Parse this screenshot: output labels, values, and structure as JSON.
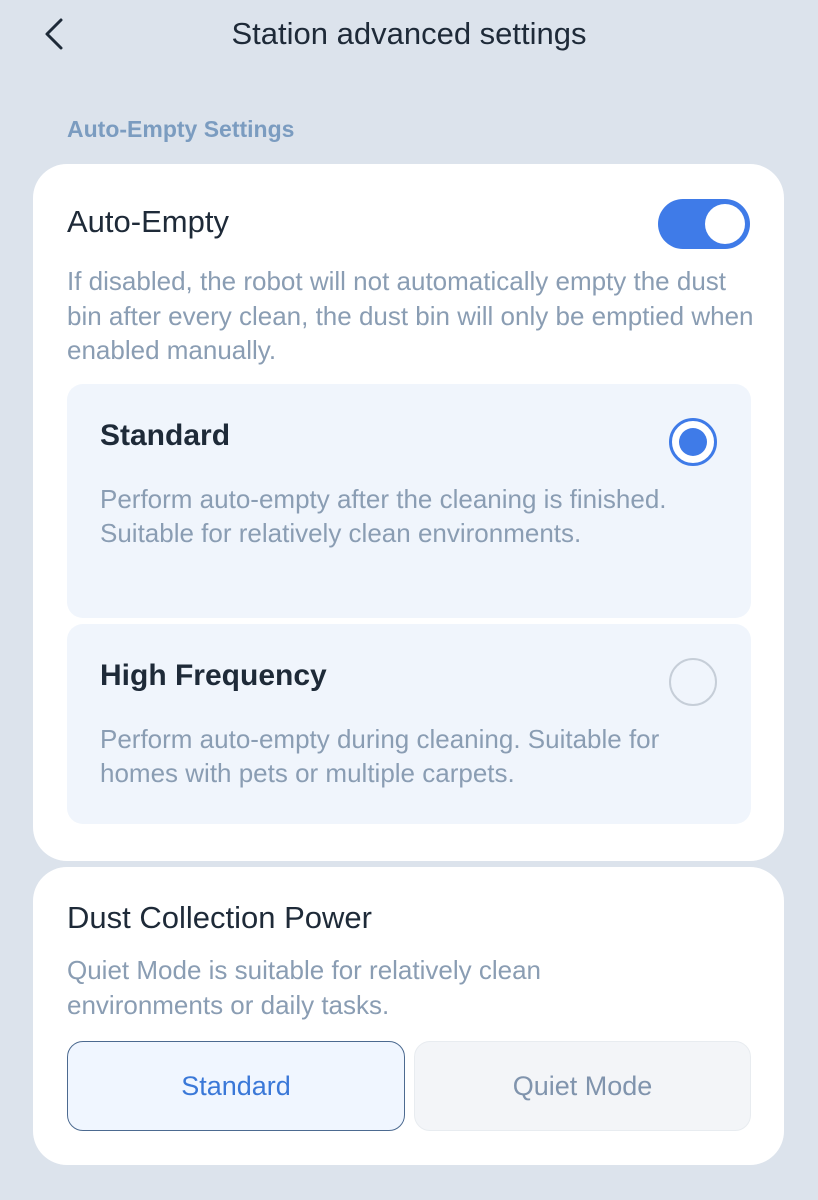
{
  "header": {
    "title": "Station advanced settings",
    "back_icon": "chevron-left-icon"
  },
  "auto_empty_section": {
    "label": "Auto-Empty Settings",
    "title": "Auto-Empty",
    "toggle_state": "on",
    "description": "If disabled, the robot will not automatically empty the dust bin after every clean, the dust bin will only be emptied when enabled manually.",
    "options": [
      {
        "title": "Standard",
        "description": "Perform auto-empty after the cleaning is finished. Suitable for relatively clean environments.",
        "selected": true
      },
      {
        "title": "High Frequency",
        "description": "Perform auto-empty during cleaning. Suitable for homes with pets or multiple carpets.",
        "selected": false
      }
    ]
  },
  "dust_power_section": {
    "title": "Dust Collection Power",
    "description": "Quiet Mode is suitable for relatively clean environments or daily tasks.",
    "buttons": [
      {
        "label": "Standard",
        "selected": true
      },
      {
        "label": "Quiet Mode",
        "selected": false
      }
    ]
  },
  "colors": {
    "accent": "#3f7be8",
    "background": "#dce3ec",
    "section_label": "#7b9cc0",
    "muted_text": "#8a9db3"
  }
}
